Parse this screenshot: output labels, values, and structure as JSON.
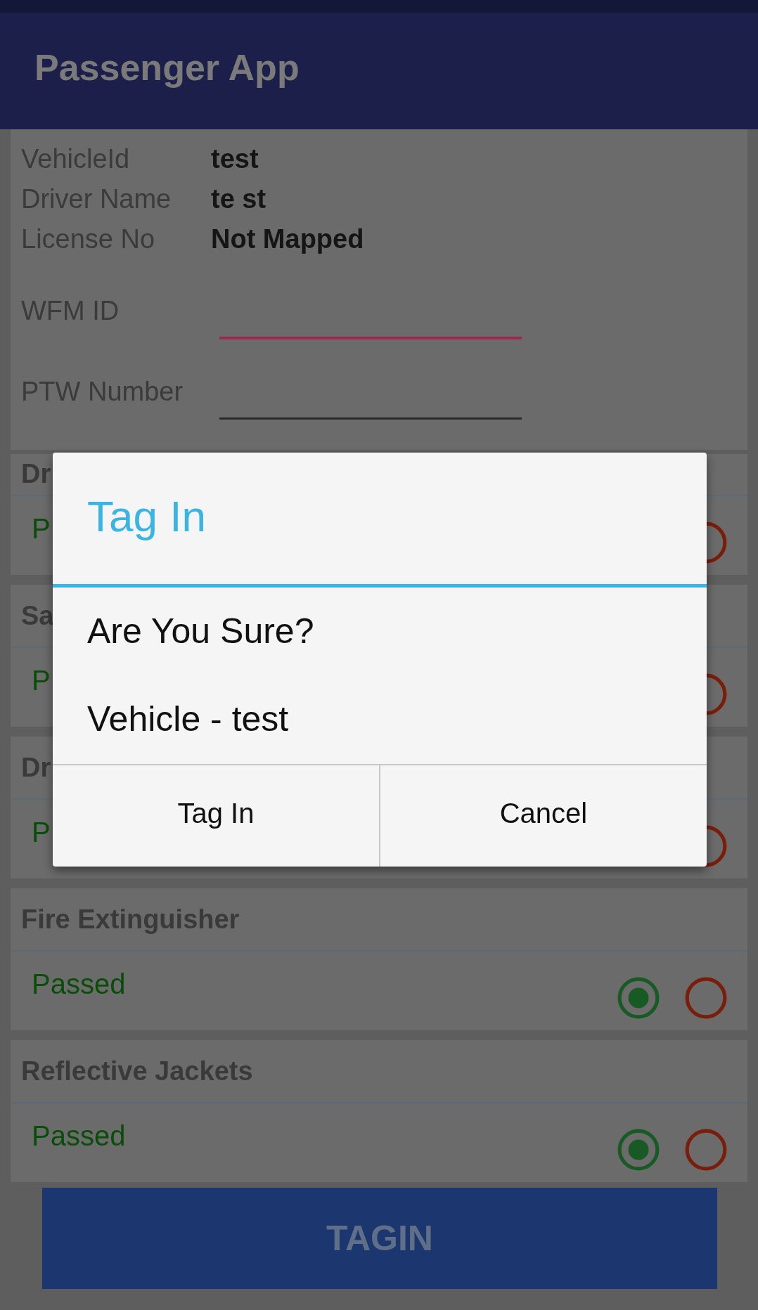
{
  "app_bar": {
    "title": "Passenger App"
  },
  "details": [
    {
      "label": "VehicleId",
      "value": "test"
    },
    {
      "label": "Driver Name",
      "value": "te st"
    },
    {
      "label": "License No",
      "value": "Not Mapped"
    }
  ],
  "fields": [
    {
      "label": "WFM ID",
      "focused": true
    },
    {
      "label": "PTW Number",
      "focused": false
    }
  ],
  "checks": [
    {
      "title": "Dr",
      "status": "P",
      "failed": false
    },
    {
      "title": "Sa",
      "status": "P",
      "failed": false
    },
    {
      "title": "Dr",
      "status": "P",
      "failed": false
    },
    {
      "title": "Fire Extinguisher",
      "status": "Passed",
      "passed": true,
      "failed": false
    },
    {
      "title": "Reflective Jackets",
      "status": "Passed",
      "passed": true,
      "failed": false
    }
  ],
  "submit_button": "TAGIN",
  "dialog": {
    "title": "Tag In",
    "messages": [
      "Are You Sure?",
      "Vehicle - test"
    ],
    "buttons": [
      "Tag In",
      "Cancel"
    ]
  }
}
